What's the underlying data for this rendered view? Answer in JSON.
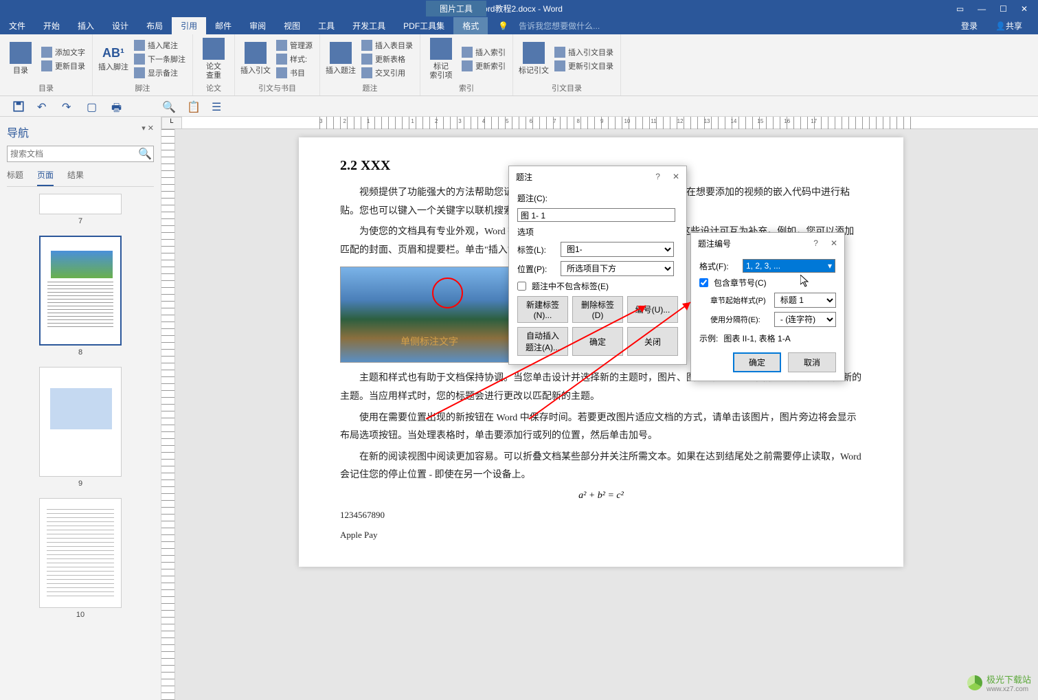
{
  "titlebar": {
    "doc_title": "Word教程2.docx - Word",
    "context_tab": "图片工具",
    "minimize": "—",
    "maximize": "☐",
    "close": "✕",
    "ribbon_opts": "▭"
  },
  "tabs": {
    "file": "文件",
    "home": "开始",
    "insert": "插入",
    "design": "设计",
    "layout": "布局",
    "references": "引用",
    "mail": "邮件",
    "review": "审阅",
    "view": "视图",
    "tools": "工具",
    "devtools": "开发工具",
    "pdftools": "PDF工具集",
    "format": "格式",
    "tellme_icon": "💡",
    "tellme": "告诉我您想要做什么...",
    "login": "登录",
    "share": "共享"
  },
  "ribbon": {
    "toc": {
      "big": "目录",
      "add_text": "添加文字",
      "update": "更新目录",
      "label": "目录"
    },
    "footnotes": {
      "big": "插入脚注",
      "ab": "AB¹",
      "insert_end": "插入尾注",
      "next": "下一条脚注",
      "show": "显示备注",
      "label": "脚注"
    },
    "research": {
      "big": "论文\n查重",
      "label": "论文"
    },
    "citations": {
      "big": "插入引文",
      "manage": "管理源",
      "style": "样式:",
      "biblio": "书目",
      "label": "引文与书目"
    },
    "captions": {
      "big": "插入题注",
      "insert_tof": "插入表目录",
      "update_table": "更新表格",
      "crossref": "交叉引用",
      "label": "题注"
    },
    "index": {
      "big": "标记\n索引项",
      "insert_index": "插入索引",
      "update_index": "更新索引",
      "label": "索引"
    },
    "toa": {
      "big": "标记引文",
      "insert_toa": "插入引文目录",
      "update_toa": "更新引文目录",
      "label": "引文目录"
    }
  },
  "nav": {
    "title": "导航",
    "pin": "▾ ✕",
    "search_placeholder": "搜索文档",
    "tab_headings": "标题",
    "tab_pages": "页面",
    "tab_results": "结果",
    "pages": [
      "7",
      "8",
      "9",
      "10"
    ]
  },
  "ruler_corner": "L",
  "doc": {
    "heading": "2.2 XXX",
    "p1": "视频提供了功能强大的方法帮助您证明您的观点。当您单击联机视频时，可以在想要添加的视频的嵌入代码中进行粘贴。您也可以键入一个关键字以联机搜索最适合您的文档的视频。",
    "p2": "为使您的文档具有专业外观，Word 提供了页眉、页脚、封面和文本框设计，这些设计可互为补充。例如，您可以添加匹配的封面、页眉和提要栏。单击\"插入\"，然后从不同库中选择所需元素。",
    "img_label": "单侧标注文字",
    "p3": "主题和样式也有助于文档保持协调。当您单击设计并选择新的主题时，图片、图表或 SmartArt 图形将会更改以匹配新的主题。当应用样式时，您的标题会进行更改以匹配新的主题。",
    "p4": "使用在需要位置出现的新按钮在 Word 中保存时间。若要更改图片适应文档的方式，请单击该图片，图片旁边将会显示布局选项按钮。当处理表格时，单击要添加行或列的位置，然后单击加号。",
    "p5": "在新的阅读视图中阅读更加容易。可以折叠文档某些部分并关注所需文本。如果在达到结尾处之前需要停止读取，Word 会记住您的停止位置 - 即使在另一个设备上。",
    "eq": "a² + b² = c²",
    "plain1": "1234567890",
    "plain2": "Apple Pay"
  },
  "dlg_caption": {
    "title": "题注",
    "help": "?",
    "close": "✕",
    "caption_label": "题注(C):",
    "caption_value": "图 1- 1",
    "options": "选项",
    "label_label": "标签(L):",
    "label_value": "图1-",
    "position_label": "位置(P):",
    "position_value": "所选项目下方",
    "exclude": "题注中不包含标签(E)",
    "new_label": "新建标签(N)...",
    "delete_label": "删除标签(D)",
    "numbering": "编号(U)...",
    "autocaption": "自动插入题注(A)...",
    "ok": "确定",
    "cancel": "关闭"
  },
  "dlg_number": {
    "title": "题注编号",
    "help": "?",
    "close": "✕",
    "format_label": "格式(F):",
    "format_value": "1, 2, 3, ...",
    "include_chapter": "包含章节号(C)",
    "chapter_start": "章节起始样式(P)",
    "chapter_start_value": "标题 1",
    "separator": "使用分隔符(E):",
    "separator_value": "- (连字符)",
    "example_label": "示例:",
    "example_value": "图表 II-1, 表格 1-A",
    "ok": "确定",
    "cancel": "取消"
  },
  "watermark": {
    "cn": "极光下载站",
    "url": "www.xz7.com"
  }
}
